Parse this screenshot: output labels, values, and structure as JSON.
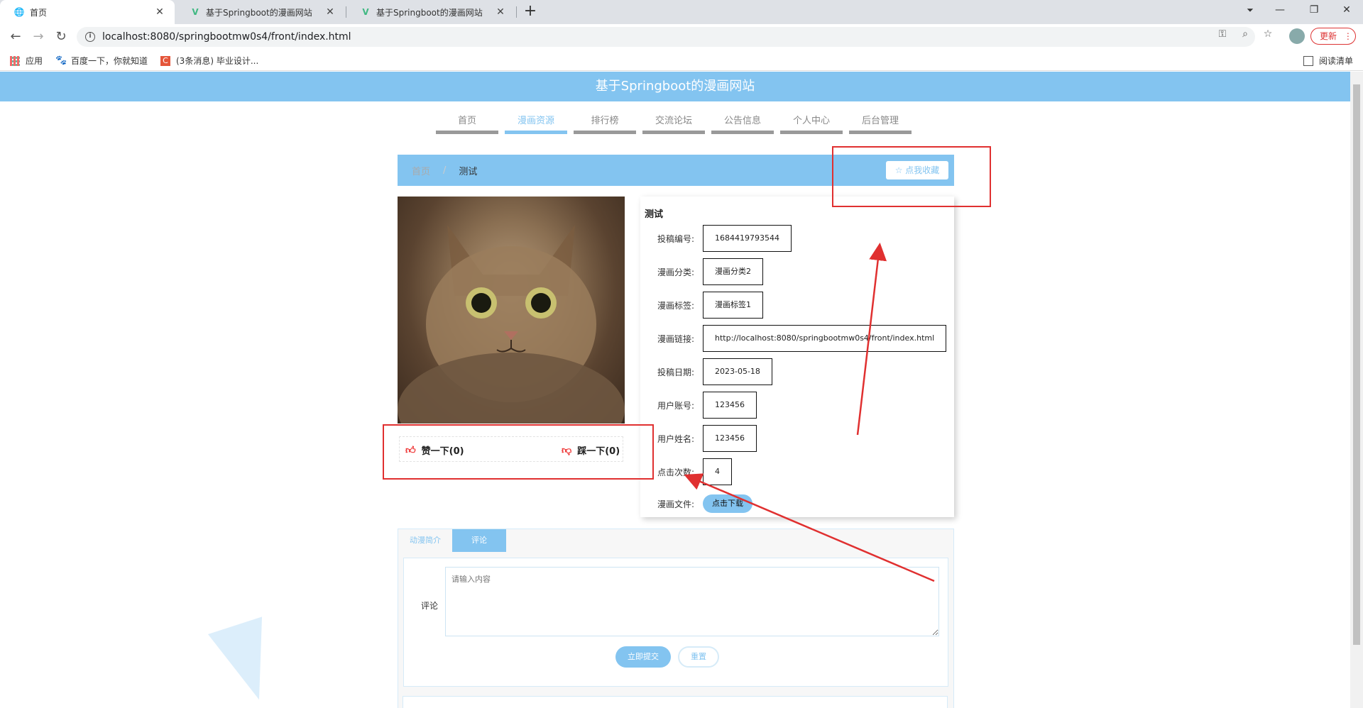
{
  "browser": {
    "tabs": [
      {
        "title": "首页",
        "icon": "globe-icon"
      },
      {
        "title": "基于Springboot的漫画网站",
        "icon": "vue-icon"
      },
      {
        "title": "基于Springboot的漫画网站",
        "icon": "vue-icon"
      }
    ],
    "url": "localhost:8080/springbootmw0s4/front/index.html",
    "update_label": "更新",
    "bookmarks": [
      {
        "label": "应用",
        "icon": "apps-grid-icon"
      },
      {
        "label": "百度一下，你就知道",
        "icon": "baidu-paw-icon"
      },
      {
        "label": "(3条消息) 毕业设计...",
        "icon": "csdn-icon"
      }
    ],
    "reading_list_label": "阅读清单"
  },
  "site": {
    "title": "基于Springboot的漫画网站",
    "nav": [
      "首页",
      "漫画资源",
      "排行榜",
      "交流论坛",
      "公告信息",
      "个人中心",
      "后台管理"
    ],
    "active_nav_index": 1
  },
  "breadcrumb": {
    "home": "首页",
    "separator": "/",
    "current": "测试",
    "favorite_label": "☆ 点我收藏"
  },
  "votes": {
    "like_label": "赞一下(0)",
    "dislike_label": "踩一下(0)"
  },
  "detail": {
    "title": "测试",
    "fields": [
      {
        "label": "投稿编号:",
        "value": "1684419793544"
      },
      {
        "label": "漫画分类:",
        "value": "漫画分类2"
      },
      {
        "label": "漫画标签:",
        "value": "漫画标签1"
      },
      {
        "label": "漫画链接:",
        "value": "http://localhost:8080/springbootmw0s4/front/index.html"
      },
      {
        "label": "投稿日期:",
        "value": "2023-05-18"
      },
      {
        "label": "用户账号:",
        "value": "123456"
      },
      {
        "label": "用户姓名:",
        "value": "123456"
      },
      {
        "label": "点击次数:",
        "value": "4"
      }
    ],
    "file_label": "漫画文件:",
    "download_label": "点击下载"
  },
  "tabs": {
    "items": [
      "动漫简介",
      "评论"
    ],
    "active_index": 1
  },
  "comment": {
    "label": "评论",
    "placeholder": "请输入内容",
    "submit_label": "立即提交",
    "reset_label": "重置"
  },
  "colors": {
    "accent": "#83c4f0",
    "annotation": "#e03030"
  }
}
